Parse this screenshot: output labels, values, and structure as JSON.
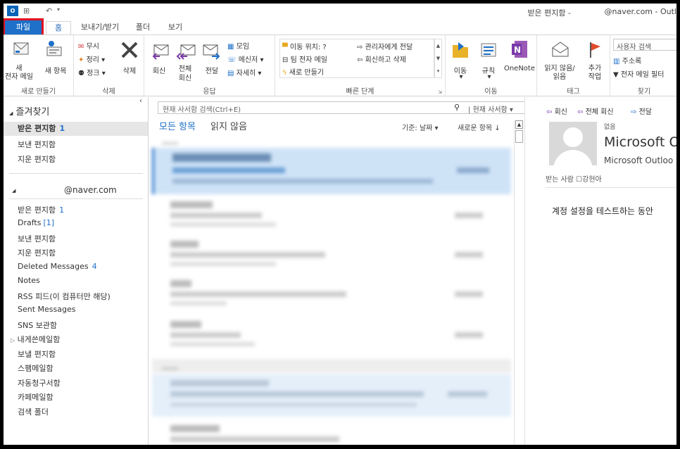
{
  "titlebar": {
    "app_icon": "O",
    "title": "받은 편지함 -",
    "account": "@naver.com - Outl"
  },
  "tabs": [
    "파일",
    "홈",
    "보내기/받기",
    "폴더",
    "보기"
  ],
  "ribbon": {
    "new_group": {
      "label": "새로 만들기",
      "new_mail": "새\n전자 메일",
      "new_items": "새 항목"
    },
    "delete_group": {
      "label": "삭제",
      "ignore": "무시",
      "cleanup": "정리",
      "junk": "정크",
      "delete": "삭제"
    },
    "respond_group": {
      "label": "응답",
      "reply": "회신",
      "reply_all": "전체\n회신",
      "forward": "전달",
      "meeting": "모임",
      "im": "메신저",
      "more": "자세히"
    },
    "quicksteps_group": {
      "label": "빠른 단계",
      "items": [
        "이동 위치: ?",
        "팀 전자 메일",
        "새로 만들기",
        "관리자에게 전달",
        "회신하고 삭제"
      ]
    },
    "move_group": {
      "label": "이동",
      "move": "이동",
      "rules": "규칙",
      "onenote": "OneNote"
    },
    "tags_group": {
      "label": "태그",
      "unread": "읽지 않음/\n읽음",
      "followup": "추가\n작업"
    },
    "find_group": {
      "label": "찾기",
      "search_people": "사용자 검색",
      "address_book": "주소록",
      "filter_mail": "전자 메일 필터"
    }
  },
  "sidebar": {
    "favorites_header": "즐겨찾기",
    "favorites": [
      {
        "label": "받은 편지함",
        "count": "1"
      },
      {
        "label": "보낸 편지함",
        "count": ""
      },
      {
        "label": "지운 편지함",
        "count": ""
      }
    ],
    "account": "@naver.com",
    "folders": [
      {
        "label": "받은 편지함",
        "count": "1"
      },
      {
        "label": "Drafts",
        "count": "[1]"
      },
      {
        "label": "보낸 편지함",
        "count": ""
      },
      {
        "label": "지운 편지함",
        "count": ""
      },
      {
        "label": "Deleted Messages",
        "count": "4"
      },
      {
        "label": "Notes",
        "count": ""
      },
      {
        "label": "RSS 피드(이 컴퓨터만 해당)",
        "count": ""
      },
      {
        "label": "Sent Messages",
        "count": ""
      },
      {
        "label": "SNS 보관함",
        "count": ""
      },
      {
        "label": "내게쓴메일함",
        "count": ""
      },
      {
        "label": "보낼 편지함",
        "count": ""
      },
      {
        "label": "스팸메일함",
        "count": ""
      },
      {
        "label": "자동청구서함",
        "count": ""
      },
      {
        "label": "카페메일함",
        "count": ""
      },
      {
        "label": "검색 폴더",
        "count": ""
      }
    ]
  },
  "maillist": {
    "search_placeholder": "현재 사서함 검색(Ctrl+E)",
    "search_scope": "현재 사서함",
    "filter_all": "모든 항목",
    "filter_unread": "읽지 않음",
    "sort_by": "기준: 날짜",
    "sort_order": "새로운 항목"
  },
  "reading": {
    "actions": [
      "회신",
      "전체 회신",
      "전달"
    ],
    "none_label": "없음",
    "from": "Microsoft O",
    "sender": "Microsoft Outloo",
    "to_label": "받는 사람",
    "to_name": "강현아",
    "body": "계정 설정을 테스트하는 동안"
  },
  "colors": {
    "accent": "#1e70c9",
    "file_tab": "#1e70c9",
    "highlight": "#e01020",
    "selected_row": "#cfe3f7"
  }
}
